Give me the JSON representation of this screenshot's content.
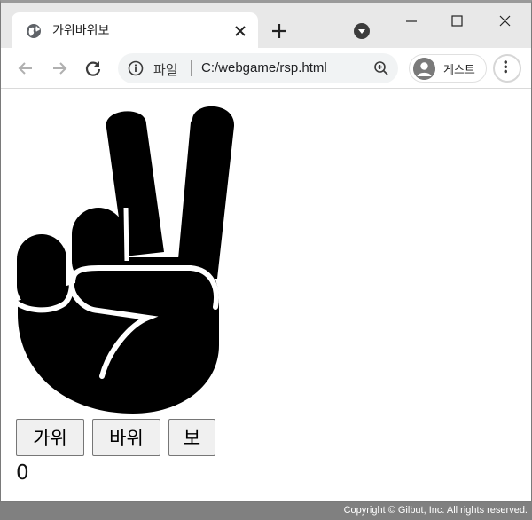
{
  "tab": {
    "title": "가위바위보"
  },
  "address_bar": {
    "scheme_label": "파일",
    "url": "C:/webgame/rsp.html"
  },
  "profile": {
    "label": "게스트"
  },
  "page": {
    "buttons": {
      "scissors": "가위",
      "rock": "바위",
      "paper": "보"
    },
    "score": "0"
  },
  "icons": {
    "favicon": "globe-icon",
    "tab_close": "close-icon",
    "new_tab": "plus-icon",
    "tab_search": "chevron-down-icon",
    "back": "arrow-left-icon",
    "forward": "arrow-right-icon",
    "reload": "reload-icon",
    "site_info": "info-icon",
    "zoom": "zoom-icon",
    "avatar": "person-icon",
    "menu": "kebab-menu-icon",
    "hand_image": "peace-sign-hand"
  },
  "colors": {
    "tab_bar": "#e8e8e8",
    "omnibox": "#f1f3f4",
    "footer": "#808080"
  },
  "footer": {
    "copyright": "Copyright © Gilbut, Inc. All rights reserved."
  }
}
